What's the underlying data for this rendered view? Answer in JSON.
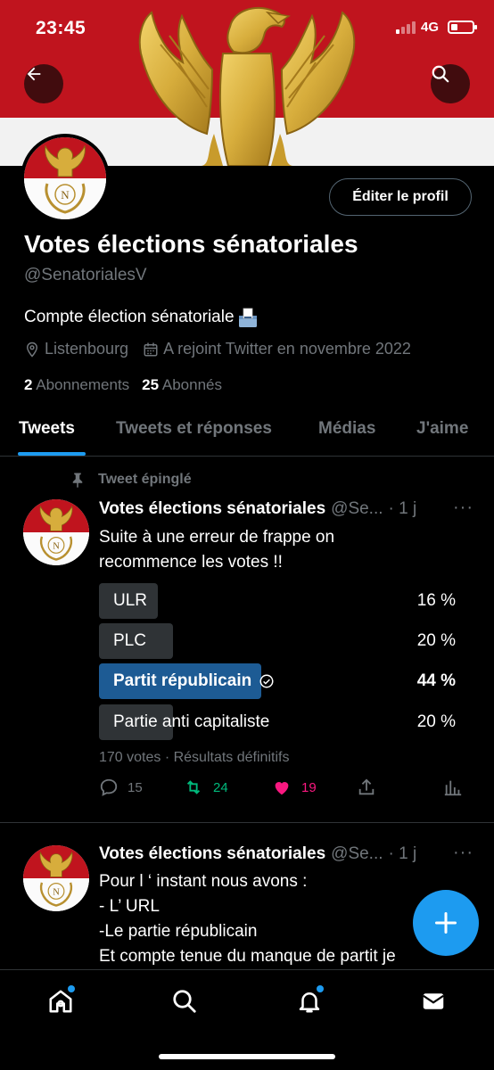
{
  "status_bar": {
    "time": "23:45",
    "network": "4G"
  },
  "profile": {
    "edit_label": "Éditer le profil",
    "name": "Votes élections sénatoriales",
    "handle": "@SenatorialesV",
    "bio": "Compte élection sénatoriale",
    "location": "Listenbourg",
    "joined": "A rejoint Twitter en novembre 2022",
    "following_count": "2",
    "following_label": "Abonnements",
    "followers_count": "25",
    "followers_label": "Abonnés",
    "avatar_letter": "N"
  },
  "tabs": [
    "Tweets",
    "Tweets et réponses",
    "Médias",
    "J'aime"
  ],
  "pinned_label": "Tweet épinglé",
  "tweets": [
    {
      "name": "Votes élections sénatoriales",
      "handle": "@Se...",
      "time": "· 1 j",
      "more": "···",
      "text_lines": [
        "Suite à une erreur de frappe on",
        "recommence les votes !!"
      ],
      "poll": {
        "options": [
          {
            "label": "ULR",
            "percent": "16 %",
            "value": 16
          },
          {
            "label": "PLC",
            "percent": "20 %",
            "value": 20
          },
          {
            "label": "Partit républicain",
            "percent": "44 %",
            "value": 44,
            "winner": true
          },
          {
            "label": "Partie anti capitaliste",
            "percent": "20 %",
            "value": 20
          }
        ],
        "meta": "170 votes · Résultats définitifs"
      },
      "actions": {
        "replies": "15",
        "retweets": "24",
        "likes": "19"
      }
    },
    {
      "name": "Votes élections sénatoriales",
      "handle": "@Se...",
      "time": "· 1 j",
      "more": "···",
      "text_lines": [
        "Pour l ‘ instant nous avons :",
        "- L’ URL",
        "-Le partie républicain",
        "Et compte tenue du manque de partit je"
      ]
    }
  ],
  "colors": {
    "accent": "#1d9bf0",
    "winner_bar": "#1d5b94",
    "retweet": "#00ba7c",
    "like": "#f91880",
    "banner_red": "#c0141e"
  }
}
